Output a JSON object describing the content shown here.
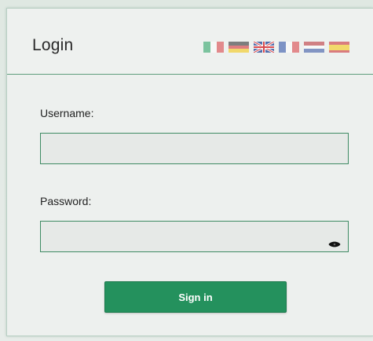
{
  "header": {
    "title": "Login",
    "languages": [
      {
        "code": "it",
        "icon": "italy-flag-icon",
        "colors": [
          "#1f9e5c",
          "#ffffff",
          "#d9363c"
        ]
      },
      {
        "code": "de",
        "icon": "germany-flag-icon",
        "colors": [
          "#222222",
          "#d21f26",
          "#f5c400"
        ]
      },
      {
        "code": "en",
        "icon": "uk-flag-icon",
        "active": true
      },
      {
        "code": "fr",
        "icon": "france-flag-icon",
        "colors": [
          "#2247a3",
          "#ffffff",
          "#d9363c"
        ]
      },
      {
        "code": "nl",
        "icon": "netherlands-flag-icon",
        "colors": [
          "#b8242b",
          "#ffffff",
          "#2b4aa0"
        ]
      },
      {
        "code": "es",
        "icon": "spain-flag-icon",
        "colors": [
          "#c81e25",
          "#f6c700",
          "#c81e25"
        ]
      }
    ]
  },
  "form": {
    "username_label": "Username:",
    "username_value": "",
    "password_label": "Password:",
    "password_value": "",
    "show_password_icon": "eye-icon",
    "submit_label": "Sign in"
  },
  "colors": {
    "accent": "#24915d",
    "border": "#3e8a63"
  }
}
